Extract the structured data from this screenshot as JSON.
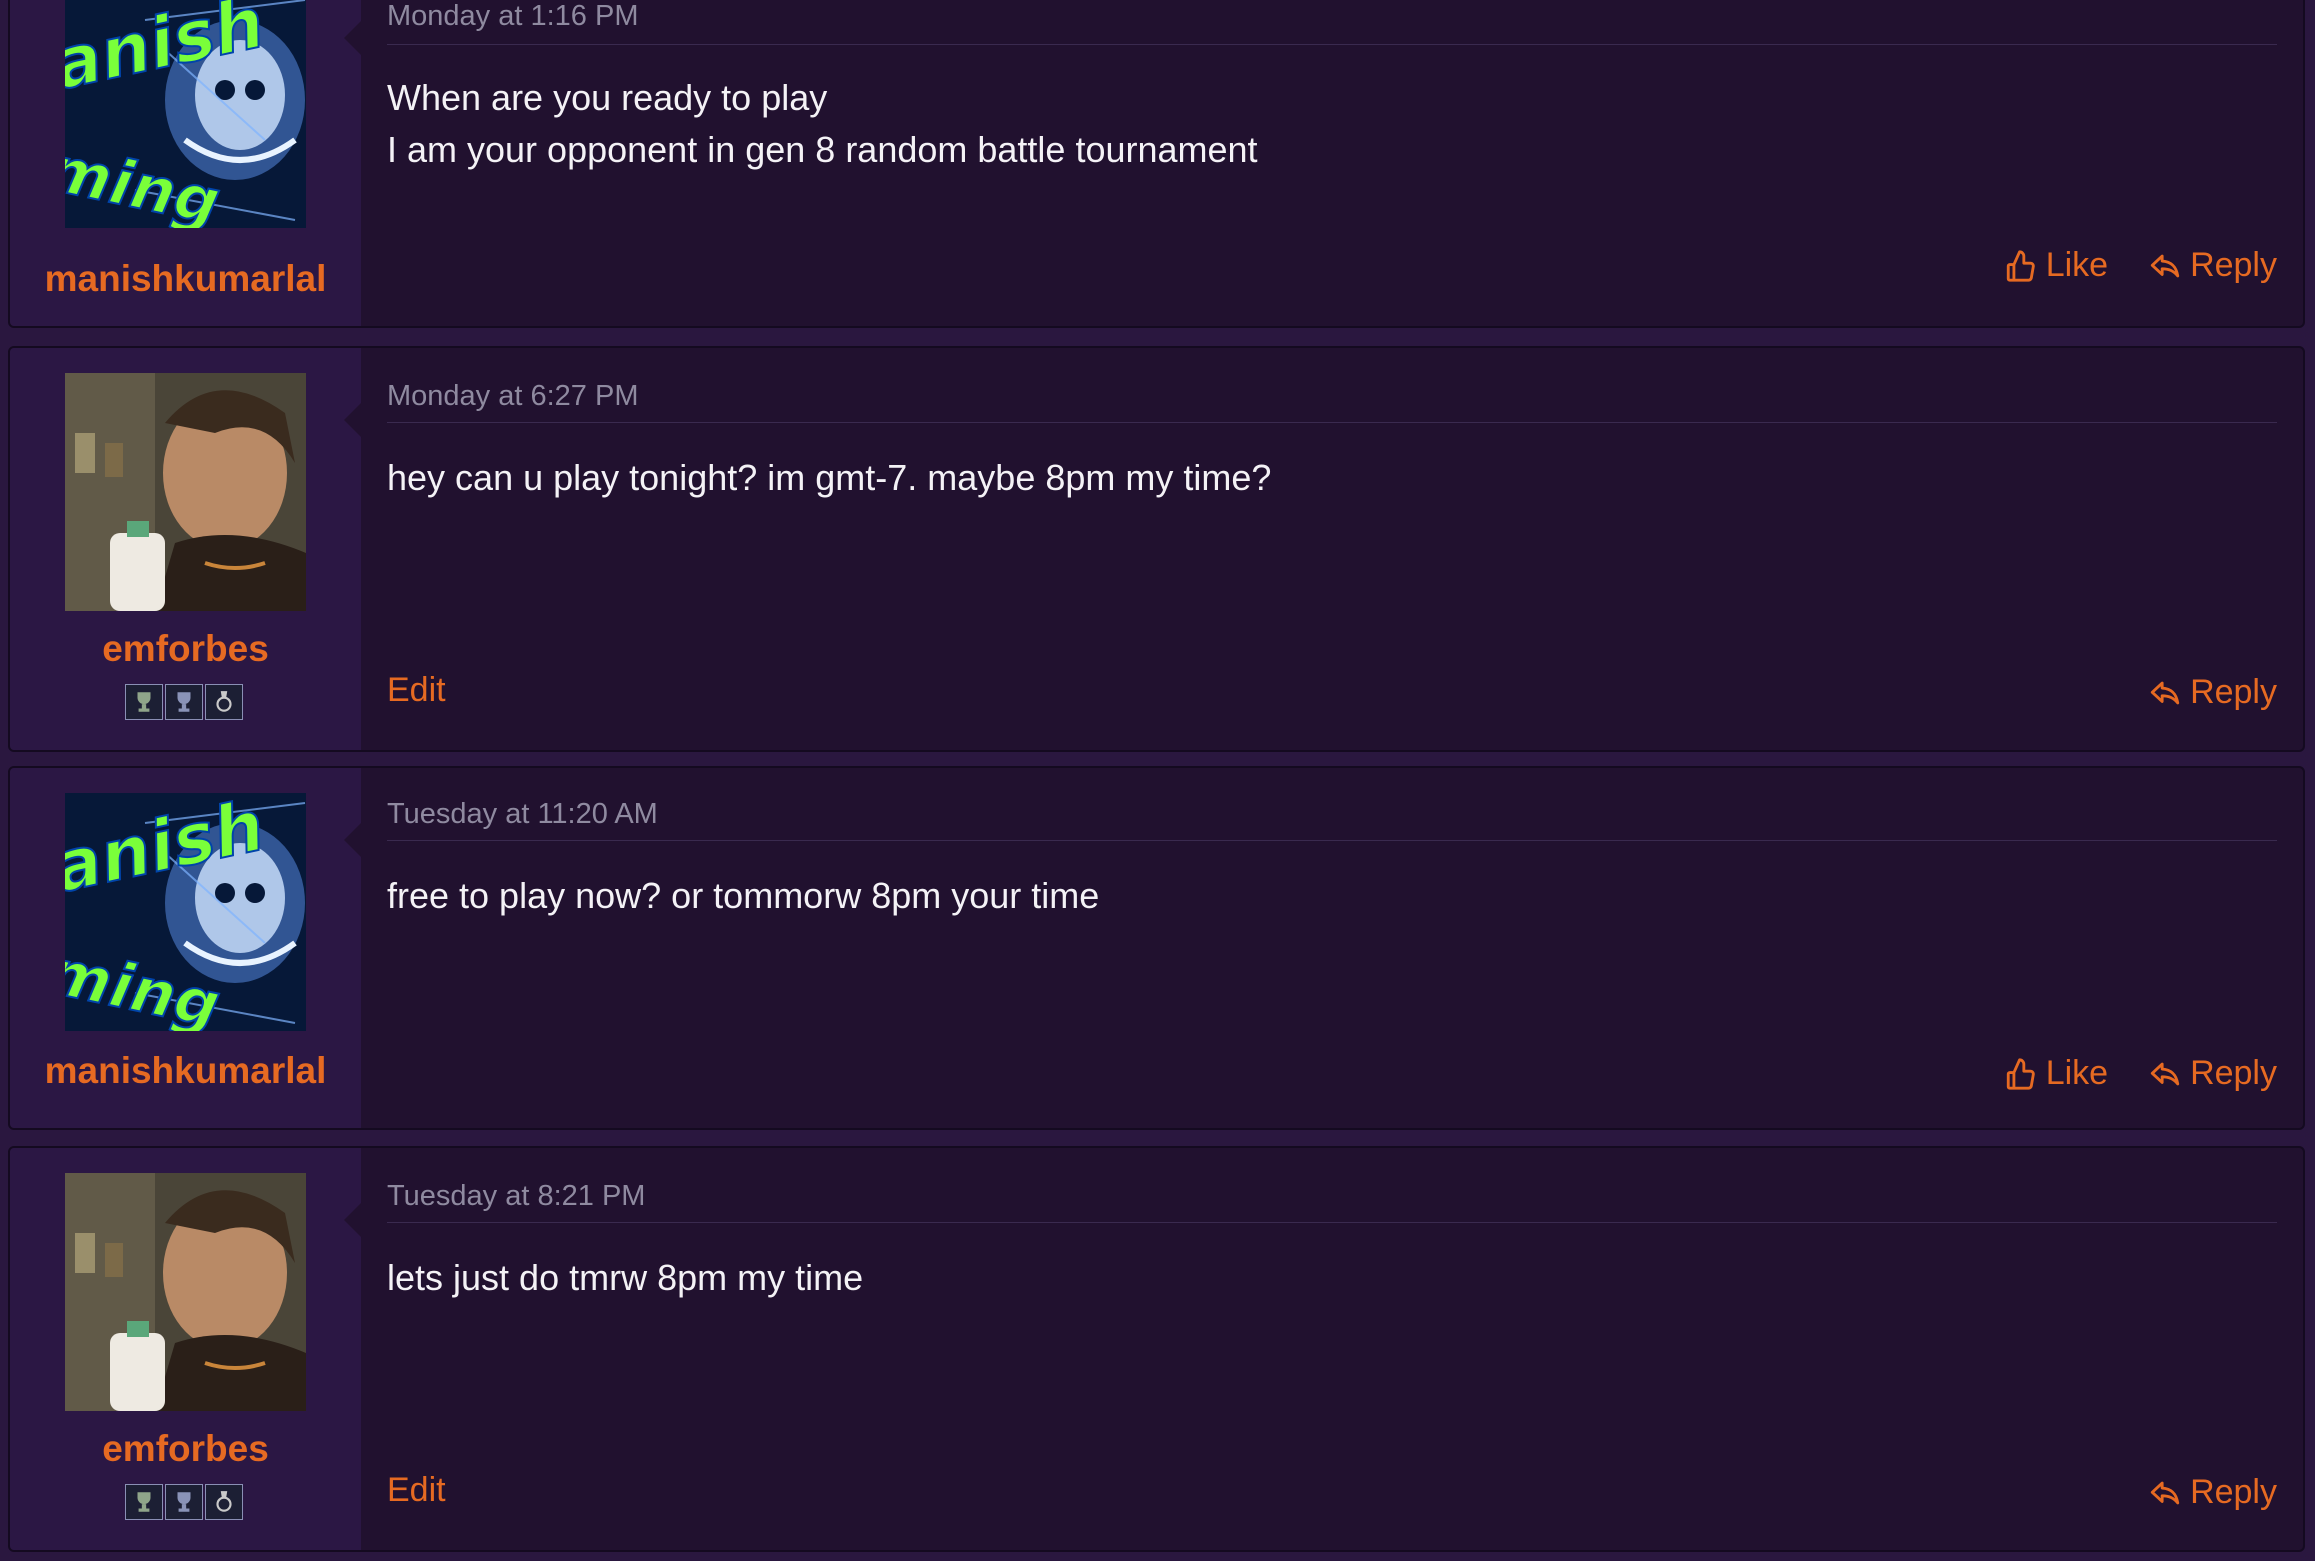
{
  "colors": {
    "page_bg": "#2a173f",
    "post_bg": "#21112f",
    "user_bg": "#2b1744",
    "accent": "#e66a22",
    "text": "#f4f2f6",
    "muted": "#8f8aa0"
  },
  "actions": {
    "like_label": "Like",
    "reply_label": "Reply",
    "edit_label": "Edit"
  },
  "posts": [
    {
      "username": "manishkumarlal",
      "avatar": "skull-gaming-avatar",
      "timestamp": "Monday at 1:16 PM",
      "lines": [
        "When are you ready to play",
        "I am your opponent in gen 8 random battle tournament"
      ],
      "actions": [
        "like-icon",
        "reply-icon"
      ]
    },
    {
      "username": "emforbes",
      "avatar": "man-with-milk-avatar",
      "timestamp": "Monday at 6:27 PM",
      "lines": [
        "hey can u play tonight? im gmt-7. maybe 8pm my time?"
      ],
      "badges": [
        "trophy-icon",
        "trophy-icon",
        "medal-icon"
      ],
      "actions": [
        "edit-link",
        "reply-icon"
      ]
    },
    {
      "username": "manishkumarlal",
      "avatar": "skull-gaming-avatar",
      "timestamp": "Tuesday at 11:20 AM",
      "lines": [
        "free to play now? or tommorw 8pm your time"
      ],
      "actions": [
        "like-icon",
        "reply-icon"
      ]
    },
    {
      "username": "emforbes",
      "avatar": "man-with-milk-avatar",
      "timestamp": "Tuesday at 8:21 PM",
      "lines": [
        "lets just do tmrw 8pm my time"
      ],
      "badges": [
        "trophy-icon",
        "trophy-icon",
        "medal-icon"
      ],
      "actions": [
        "edit-link",
        "reply-icon"
      ]
    }
  ]
}
